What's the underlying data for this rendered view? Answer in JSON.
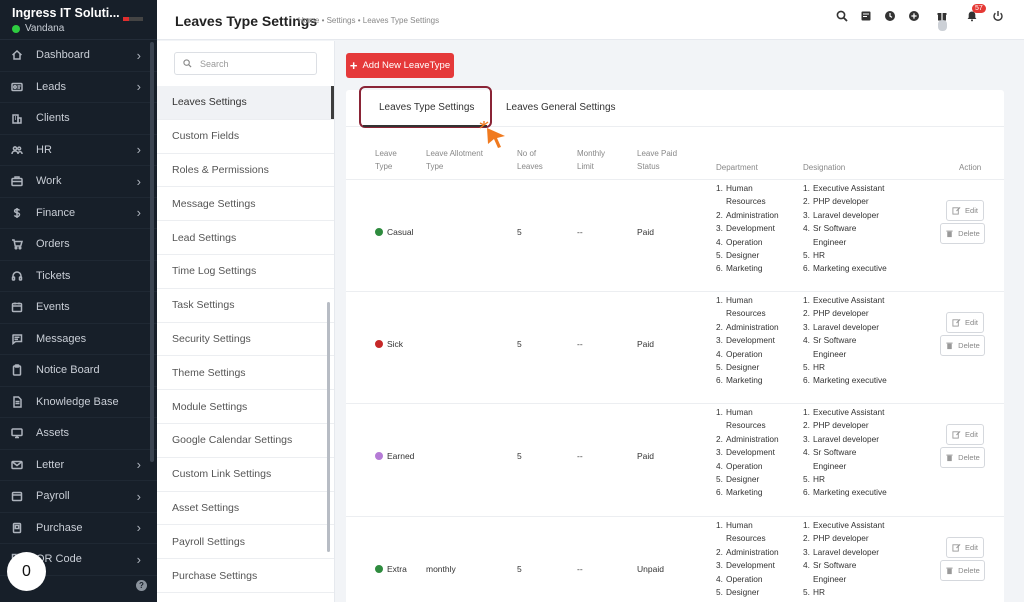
{
  "sidebar": {
    "company": "Ingress IT Soluti...",
    "user": "Vandana",
    "items": [
      {
        "label": "Dashboard",
        "icon": "home-icon",
        "chevron": true
      },
      {
        "label": "Leads",
        "icon": "id-card-icon",
        "chevron": true
      },
      {
        "label": "Clients",
        "icon": "building-icon",
        "chevron": false
      },
      {
        "label": "HR",
        "icon": "users-icon",
        "chevron": true
      },
      {
        "label": "Work",
        "icon": "briefcase-icon",
        "chevron": true
      },
      {
        "label": "Finance",
        "icon": "dollar-icon",
        "chevron": true
      },
      {
        "label": "Orders",
        "icon": "cart-icon",
        "chevron": false
      },
      {
        "label": "Tickets",
        "icon": "headset-icon",
        "chevron": false
      },
      {
        "label": "Events",
        "icon": "calendar-icon",
        "chevron": false
      },
      {
        "label": "Messages",
        "icon": "chat-icon",
        "chevron": false
      },
      {
        "label": "Notice Board",
        "icon": "clipboard-icon",
        "chevron": false
      },
      {
        "label": "Knowledge Base",
        "icon": "document-icon",
        "chevron": false
      },
      {
        "label": "Assets",
        "icon": "monitor-icon",
        "chevron": false
      },
      {
        "label": "Letter",
        "icon": "envelope-icon",
        "chevron": true
      },
      {
        "label": "Payroll",
        "icon": "wallet-icon",
        "chevron": true
      },
      {
        "label": "Purchase",
        "icon": "receipt-icon",
        "chevron": true
      },
      {
        "label": "QR Code",
        "icon": "qr-icon",
        "chevron": true
      }
    ],
    "floating_badge": "0"
  },
  "header": {
    "title": "Leaves Type Settings",
    "breadcrumb": "Home • Settings • Leaves Type Settings",
    "notification_count": "57"
  },
  "settings_menu": {
    "search_placeholder": "Search",
    "items": [
      "Leaves Settings",
      "Custom Fields",
      "Roles & Permissions",
      "Message Settings",
      "Lead Settings",
      "Time Log Settings",
      "Task Settings",
      "Security Settings",
      "Theme Settings",
      "Module Settings",
      "Google Calendar Settings",
      "Custom Link Settings",
      "Asset Settings",
      "Payroll Settings",
      "Purchase Settings"
    ],
    "active_index": 0
  },
  "main": {
    "add_button": "Add New LeaveType",
    "tabs": [
      "Leaves Type Settings",
      "Leaves General Settings"
    ],
    "columns": {
      "leave_type": [
        "Leave",
        "Type"
      ],
      "allotment": [
        "Leave Allotment",
        "Type"
      ],
      "no_of_leaves": [
        "No of",
        "Leaves"
      ],
      "monthly_limit": [
        "Monthly",
        "Limit"
      ],
      "paid_status": [
        "Leave Paid",
        "Status"
      ],
      "department": "Department",
      "designation": "Designation",
      "action": "Action"
    },
    "edit_label": "Edit",
    "delete_label": "Delete",
    "rows": [
      {
        "type": "Casual",
        "color": "#2e8b3e",
        "allotment": "",
        "leaves": "5",
        "limit": "--",
        "paid": "Paid"
      },
      {
        "type": "Sick",
        "color": "#c62828",
        "allotment": "",
        "leaves": "5",
        "limit": "--",
        "paid": "Paid"
      },
      {
        "type": "Earned",
        "color": "#b57bd6",
        "allotment": "",
        "leaves": "5",
        "limit": "--",
        "paid": "Paid"
      },
      {
        "type": "Extra",
        "color": "#2e8b3e",
        "allotment": "monthly",
        "leaves": "5",
        "limit": "--",
        "paid": "Unpaid"
      }
    ],
    "departments": [
      {
        "n": "1.",
        "t": "Human"
      },
      {
        "n": "",
        "t": "Resources"
      },
      {
        "n": "2.",
        "t": "Administration"
      },
      {
        "n": "3.",
        "t": "Development"
      },
      {
        "n": "4.",
        "t": "Operation"
      },
      {
        "n": "5.",
        "t": "Designer"
      },
      {
        "n": "6.",
        "t": "Marketing"
      }
    ],
    "designations": [
      {
        "n": "1.",
        "t": "Executive Assistant"
      },
      {
        "n": "2.",
        "t": "PHP developer"
      },
      {
        "n": "3.",
        "t": "Laravel developer"
      },
      {
        "n": "4.",
        "t": "Sr Software"
      },
      {
        "n": "",
        "t": "Engineer"
      },
      {
        "n": "5.",
        "t": "HR"
      },
      {
        "n": "6.",
        "t": "Marketing executive"
      }
    ]
  }
}
